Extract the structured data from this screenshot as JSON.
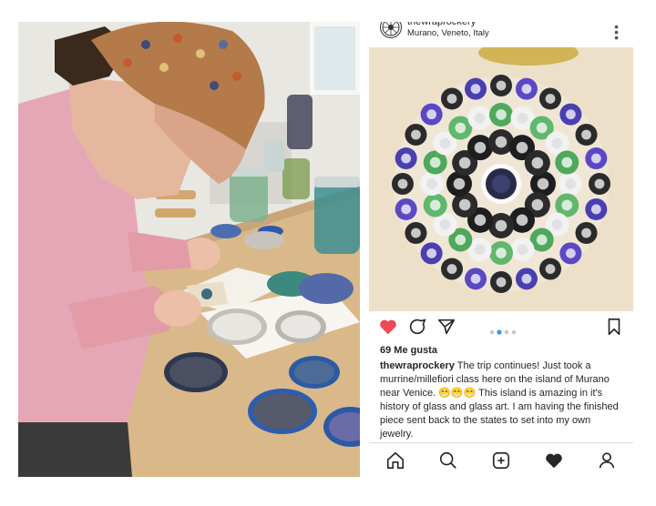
{
  "post": {
    "username": "thewraprockery",
    "location": "Murano, Veneto, Italy",
    "likes": "69 Me gusta",
    "caption_user": "thewraprockery",
    "caption_text": "The trip continues! Just took a murrine/millefiori class here on the island of Murano near Venice. 😁😁😁 This island is amazing in it's history of glass and glass art. I am having the finished piece sent back to the states to set into my own jewelry."
  },
  "icons": {
    "more": "more-vertical-icon",
    "like": "heart-filled-icon",
    "comment": "comment-icon",
    "share": "send-icon",
    "save": "bookmark-icon",
    "nav": [
      "home-icon",
      "search-icon",
      "add-icon",
      "heart-icon",
      "profile-icon"
    ]
  },
  "colors": {
    "like": "#ed4956",
    "carousel_active": "#3897f0",
    "carousel_inactive": "#c4c4c4"
  }
}
